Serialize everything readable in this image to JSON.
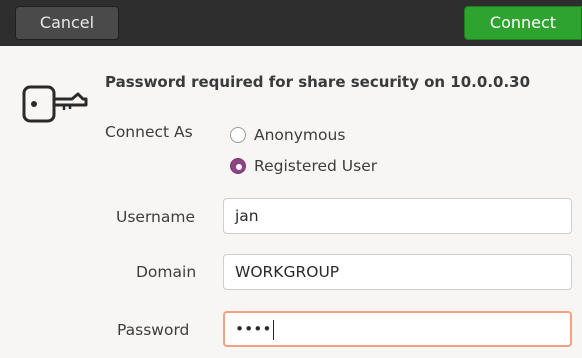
{
  "header": {
    "cancel_label": "Cancel",
    "connect_label": "Connect"
  },
  "dialog": {
    "title": "Password required for share security on 10.0.0.30",
    "connect_as_label": "Connect As",
    "options": [
      {
        "label": "Anonymous",
        "checked": false
      },
      {
        "label": "Registered User",
        "checked": true
      }
    ],
    "username": {
      "label": "Username",
      "value": "jan"
    },
    "domain": {
      "label": "Domain",
      "value": "WORKGROUP"
    },
    "password": {
      "label": "Password",
      "value": "••••"
    }
  },
  "colors": {
    "header_bg": "#2e2e2e",
    "connect_green": "#2fa32f",
    "radio_selected": "#8e4585",
    "focus_border": "#f2a283"
  },
  "icons": [
    "key-icon"
  ]
}
